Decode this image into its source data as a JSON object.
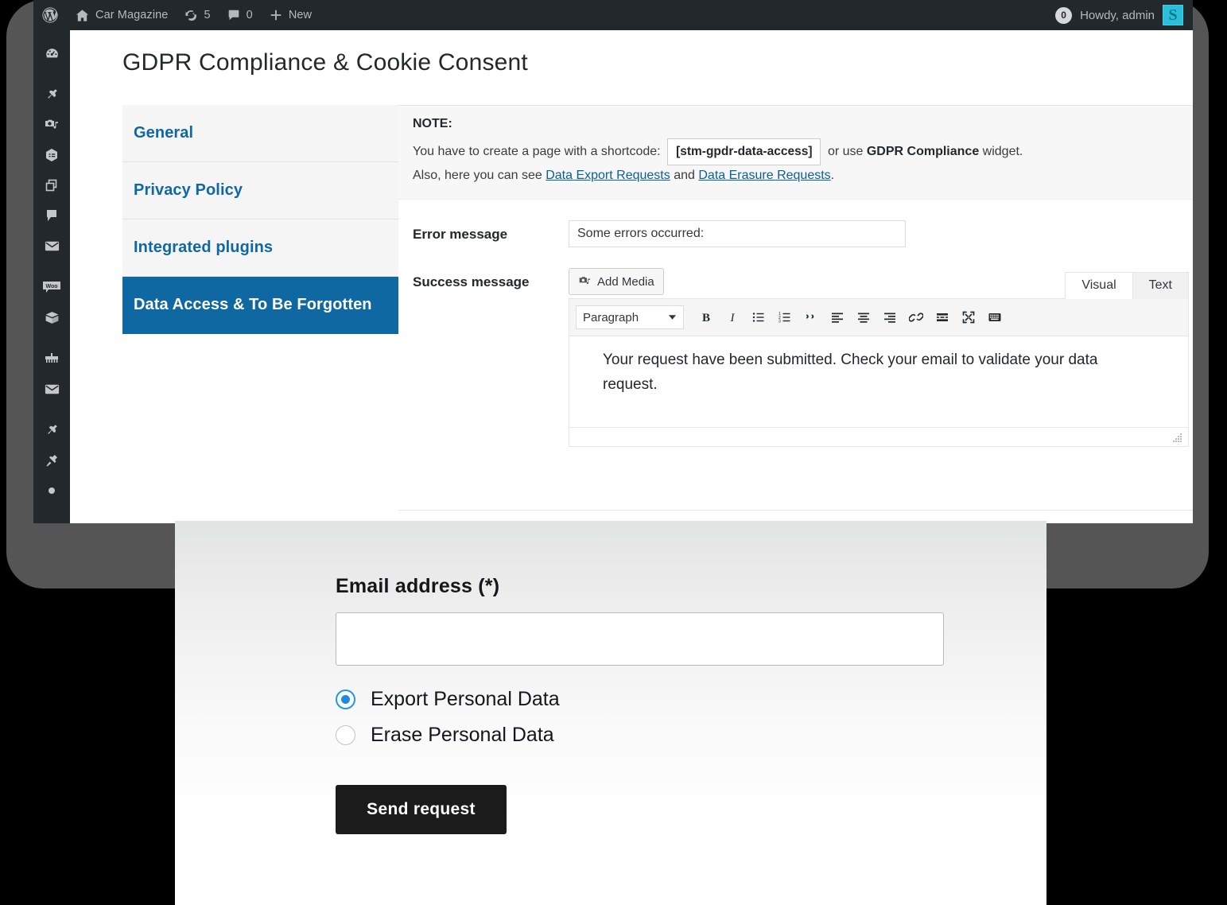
{
  "admin_bar": {
    "wp_logo_icon": "wordpress-logo-icon",
    "site_home_icon": "home-icon",
    "site_name": "Car Magazine",
    "updates_icon": "updates-icon",
    "updates_count": "5",
    "comments_icon": "comment-icon",
    "comments_count": "0",
    "new_icon": "plus-icon",
    "new_label": "New",
    "notification_count": "0",
    "howdy": "Howdy, admin",
    "avatar_letter": "S",
    "avatar_color": "#2bbfd9"
  },
  "sidebar": {
    "items": [
      {
        "icon": "dashboard-gauge-icon",
        "name": "sidebar-item-dashboard"
      },
      {
        "icon": "pin-posts-icon",
        "name": "sidebar-item-posts"
      },
      {
        "icon": "media-camera-music-icon",
        "name": "sidebar-item-media"
      },
      {
        "icon": "list-page-icon",
        "name": "sidebar-item-pages"
      },
      {
        "icon": "copy-pages-icon",
        "name": "sidebar-item-duplicate"
      },
      {
        "icon": "comment-bubble-icon",
        "name": "sidebar-item-comments"
      },
      {
        "icon": "envelope-icon",
        "name": "sidebar-item-contact"
      },
      {
        "icon": "woo-icon",
        "name": "sidebar-item-woocommerce"
      },
      {
        "icon": "box-products-icon",
        "name": "sidebar-item-products"
      },
      {
        "icon": "appearance-brush-icon",
        "name": "sidebar-item-appearance"
      },
      {
        "icon": "envelope-icon",
        "name": "sidebar-item-mail"
      },
      {
        "icon": "pin-icon",
        "name": "sidebar-item-pin"
      },
      {
        "icon": "plugin-icon",
        "name": "sidebar-item-plugins"
      },
      {
        "icon": "dot-icon",
        "name": "sidebar-item-more"
      }
    ]
  },
  "page": {
    "title": "GDPR Compliance & Cookie Consent",
    "accent_color": "#1068a3"
  },
  "tabs": [
    {
      "label": "General",
      "active": false
    },
    {
      "label": "Privacy Policy",
      "active": false
    },
    {
      "label": "Integrated plugins",
      "active": false
    },
    {
      "label": "Data Access & To Be Forgotten",
      "active": true
    }
  ],
  "note": {
    "title": "NOTE:",
    "line1_prefix": "You have to create a page with a shortcode:",
    "shortcode": "[stm-gpdr-data-access]",
    "line1_mid": "or use",
    "line1_strong": "GDPR Compliance",
    "line1_suffix": "widget.",
    "line2_prefix": "Also, here you can see",
    "link1": "Data Export Requests",
    "line2_mid": "and",
    "link2": "Data Erasure Requests",
    "line2_suffix": "."
  },
  "fields": {
    "error_message": {
      "label": "Error message",
      "value": "Some errors occurred:",
      "placeholder": ""
    },
    "success_message": {
      "label": "Success message",
      "add_media_label": "Add Media",
      "add_media_icon": "add-media-icon",
      "editor_tabs": [
        {
          "label": "Visual",
          "active": true
        },
        {
          "label": "Text",
          "active": false
        }
      ],
      "format_select": "Paragraph",
      "chevron_icon": "chevron-down-icon",
      "toolbar_buttons": [
        "bold-icon",
        "italic-icon",
        "bulleted-list-icon",
        "numbered-list-icon",
        "blockquote-icon",
        "align-left-icon",
        "align-center-icon",
        "align-right-icon",
        "link-icon",
        "read-more-icon",
        "fullscreen-icon",
        "toolbar-toggle-icon"
      ],
      "content": "Your request have been submitted. Check your email to validate your data request.",
      "resize_handle_icon": "resize-handle-icon"
    }
  },
  "frontend_form": {
    "email_label": "Email address (*)",
    "email_value": "",
    "email_placeholder": "",
    "radios": [
      {
        "label": "Export Personal Data",
        "selected": true
      },
      {
        "label": "Erase Personal Data",
        "selected": false
      }
    ],
    "submit_label": "Send request",
    "submit_color": "#1b1b1b",
    "radio_accent": "#1e88e5"
  }
}
